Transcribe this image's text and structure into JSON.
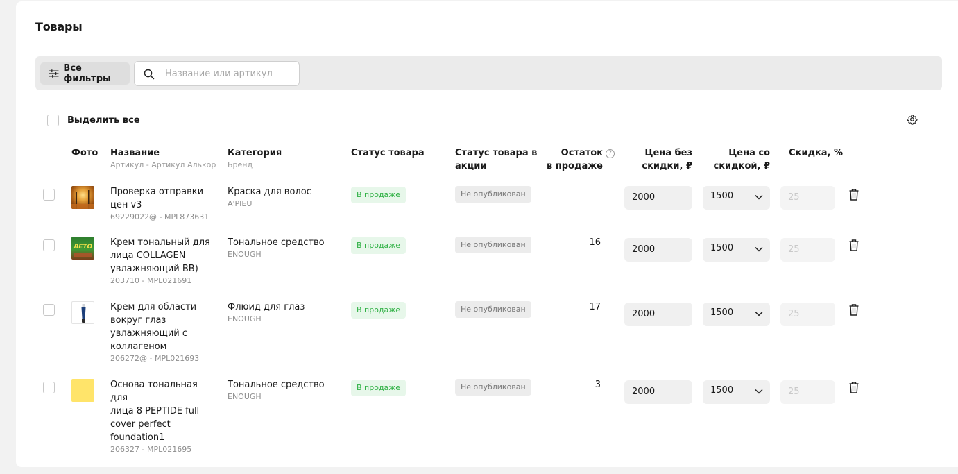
{
  "page": {
    "title": "Товары"
  },
  "toolbar": {
    "filters_label": "Все фильтры",
    "search_placeholder": "Название или артикул",
    "search_value": ""
  },
  "select_all_label": "Выделить все",
  "columns": {
    "photo": "Фото",
    "name": "Название",
    "name_sub": "Артикул - Артикул Алькор",
    "category": "Категория",
    "category_sub": "Бренд",
    "status": "Статус товара",
    "promo_status_l1": "Статус товара в",
    "promo_status_l2": "акции",
    "stock_l1": "Остаток",
    "stock_l2": "в продаже",
    "price_l1": "Цена без",
    "price_l2": "скидки, ₽",
    "sale_price_l1": "Цена со",
    "sale_price_l2": "скидкой, ₽",
    "discount": "Скидка, %"
  },
  "rows": [
    {
      "name_lines": [
        "Проверка отправки",
        "цен v3"
      ],
      "sku": "69229022@ - MPL873631",
      "category": "Краска для волос",
      "brand": "A'PIEU",
      "status": "В продаже",
      "promo_status": "Не опубликован",
      "stock": "–",
      "price": "2000",
      "sale_price": "1500",
      "discount": "25",
      "photo": "autumn-forest"
    },
    {
      "name_lines": [
        "Крем тональный для",
        "лица COLLAGEN",
        "увлажняющий BB)"
      ],
      "sku": "203710 - MPL021691",
      "category": "Тональное средство",
      "brand": "ENOUGH",
      "status": "В продаже",
      "promo_status": "Не опубликован",
      "stock": "16",
      "price": "2000",
      "sale_price": "1500",
      "discount": "25",
      "photo": "leto-banner",
      "photo_text": "ЛЕТО"
    },
    {
      "name_lines": [
        "Крем для области",
        "вокруг глаз",
        "увлажняющий с",
        "коллагеном"
      ],
      "sku": "206272@ - MPL021693",
      "category": "Флюид для глаз",
      "brand": "ENOUGH",
      "status": "В продаже",
      "promo_status": "Не опубликован",
      "stock": "17",
      "price": "2000",
      "sale_price": "1500",
      "discount": "25",
      "photo": "eye-cream-tube"
    },
    {
      "name_lines": [
        "Основа тональная для",
        "лица 8 PEPTIDE full",
        "cover perfect",
        "foundation1"
      ],
      "sku": "206327 - MPL021695",
      "category": "Тональное средство",
      "brand": "ENOUGH",
      "status": "В продаже",
      "promo_status": "Не опубликован",
      "stock": "3",
      "price": "2000",
      "sale_price": "1500",
      "discount": "25",
      "photo": "yellow-swatch"
    }
  ],
  "colors": {
    "accent_green": "#2fb144",
    "green_badge_bg": "#e7f7ea",
    "gray_badge_bg": "#ececec",
    "yellow_swatch": "#ffe46a"
  }
}
